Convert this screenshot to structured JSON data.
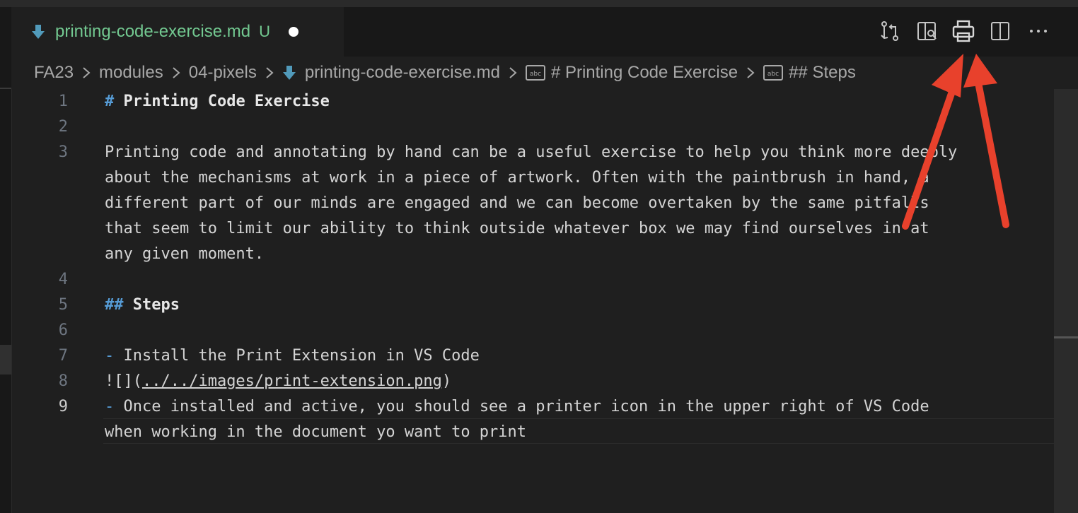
{
  "tab": {
    "title": "printing-code-exercise.md",
    "status": "U"
  },
  "toolbar": {
    "icons": [
      "open-changes-icon",
      "open-preview-icon",
      "print-icon",
      "split-editor-icon",
      "more-actions-icon"
    ]
  },
  "breadcrumb": {
    "items": [
      "FA23",
      "modules",
      "04-pixels",
      "printing-code-exercise.md",
      "# Printing Code Exercise",
      "## Steps"
    ]
  },
  "editor": {
    "line_numbers": [
      "1",
      "2",
      "3",
      "4",
      "5",
      "6",
      "7",
      "8",
      "9"
    ],
    "line1": {
      "hash": "#",
      "heading": "Printing Code Exercise"
    },
    "line3": [
      "Printing code and annotating by hand can be a useful exercise to help you think more deeply",
      "about the mechanisms at work in a piece of artwork. Often with the paintbrush in hand, a",
      "different part of our minds are engaged and we can become overtaken by the same pitfalls",
      "that seem to limit our ability to think outside whatever box we may find ourselves in at",
      "any given moment."
    ],
    "line5": {
      "hash": "##",
      "heading": "Steps"
    },
    "line7": {
      "bullet": "-",
      "text": "Install the Print Extension in VS Code"
    },
    "line8": {
      "prefix": "![](",
      "link": "../../images/print-extension.png",
      "suffix": ")"
    },
    "line9": [
      {
        "bullet": "-",
        "text": "Once installed and active, you should see a printer icon in the upper right of VS Code"
      },
      "when working in the document yo want to print"
    ]
  },
  "colors": {
    "background": "#1f1f1f",
    "modified_file": "#73c991",
    "markdown_punctuation": "#569cd6",
    "annotation_arrow": "#e8412c"
  }
}
